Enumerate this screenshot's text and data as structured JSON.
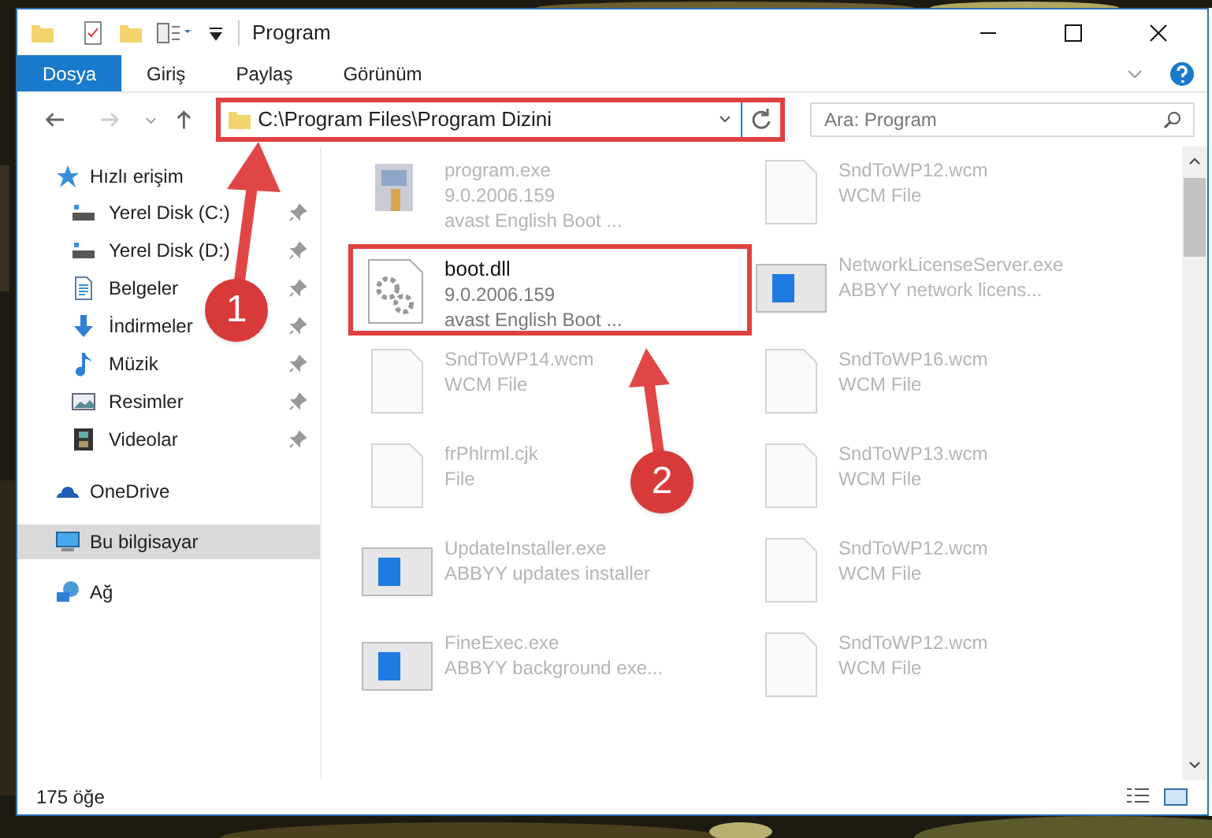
{
  "window": {
    "title": "Program"
  },
  "ribbon_tabs": [
    {
      "label": "Dosya",
      "selected": true
    },
    {
      "label": "Giriş",
      "selected": false
    },
    {
      "label": "Paylaş",
      "selected": false
    },
    {
      "label": "Görünüm",
      "selected": false
    }
  ],
  "address": {
    "path": "C:\\Program Files\\Program Dizini",
    "highlighted": true
  },
  "search": {
    "placeholder": "Ara: Program"
  },
  "nav": [
    {
      "label": "Hızlı erişim",
      "kind": "star",
      "selected": false,
      "children": [
        {
          "label": "Yerel Disk (C:)",
          "kind": "drive",
          "pinned": true,
          "selected": false
        },
        {
          "label": "Yerel Disk (D:)",
          "kind": "drive",
          "pinned": true,
          "selected": false
        },
        {
          "label": "Belgeler",
          "kind": "documents",
          "pinned": true,
          "selected": false
        },
        {
          "label": "İndirmeler",
          "kind": "download",
          "pinned": true,
          "selected": false
        },
        {
          "label": "Müzik",
          "kind": "music",
          "pinned": true,
          "selected": false
        },
        {
          "label": "Resimler",
          "kind": "pictures",
          "pinned": true,
          "selected": false
        },
        {
          "label": "Videolar",
          "kind": "video",
          "pinned": true,
          "selected": false
        }
      ]
    },
    {
      "label": "OneDrive",
      "kind": "cloud",
      "selected": false
    },
    {
      "label": "Bu bilgisayar",
      "kind": "computer",
      "selected": true
    },
    {
      "label": "Ağ",
      "kind": "network",
      "selected": false
    }
  ],
  "files": [
    {
      "kind": "exe",
      "name": "program.exe",
      "lines": [
        "9.0.2006.159",
        "avast English Boot ..."
      ],
      "highlighted": false,
      "faded": true
    },
    {
      "kind": "doc",
      "name": "SndToWP12.wcm",
      "lines": [
        "WCM File"
      ],
      "highlighted": false,
      "faded": true
    },
    {
      "kind": "dll",
      "name": "boot.dll",
      "lines": [
        "9.0.2006.159",
        "avast English Boot ..."
      ],
      "highlighted": true,
      "faded": false
    },
    {
      "kind": "app",
      "name": "NetworkLicenseServer.exe",
      "lines": [
        "ABBYY network licens..."
      ],
      "highlighted": false,
      "faded": true
    },
    {
      "kind": "doc",
      "name": "SndToWP14.wcm",
      "lines": [
        "WCM File"
      ],
      "highlighted": false,
      "faded": true
    },
    {
      "kind": "doc",
      "name": "SndToWP16.wcm",
      "lines": [
        "WCM File"
      ],
      "highlighted": false,
      "faded": true
    },
    {
      "kind": "doc",
      "name": "frPhlrml.cjk",
      "lines": [
        "File"
      ],
      "highlighted": false,
      "faded": true
    },
    {
      "kind": "doc",
      "name": "SndToWP13.wcm",
      "lines": [
        "WCM File"
      ],
      "highlighted": false,
      "faded": true
    },
    {
      "kind": "app",
      "name": "UpdateInstaller.exe",
      "lines": [
        "ABBYY updates installer"
      ],
      "highlighted": false,
      "faded": true
    },
    {
      "kind": "doc",
      "name": "SndToWP12.wcm",
      "lines": [
        "WCM File"
      ],
      "highlighted": false,
      "faded": true
    },
    {
      "kind": "app",
      "name": "FineExec.exe",
      "lines": [
        "ABBYY background exe..."
      ],
      "highlighted": false,
      "faded": true
    },
    {
      "kind": "doc",
      "name": "SndToWP12.wcm",
      "lines": [
        "WCM File"
      ],
      "highlighted": false,
      "faded": true
    }
  ],
  "markers": [
    {
      "number": "1"
    },
    {
      "number": "2"
    }
  ],
  "status_bar": {
    "count": "175 öğe"
  }
}
